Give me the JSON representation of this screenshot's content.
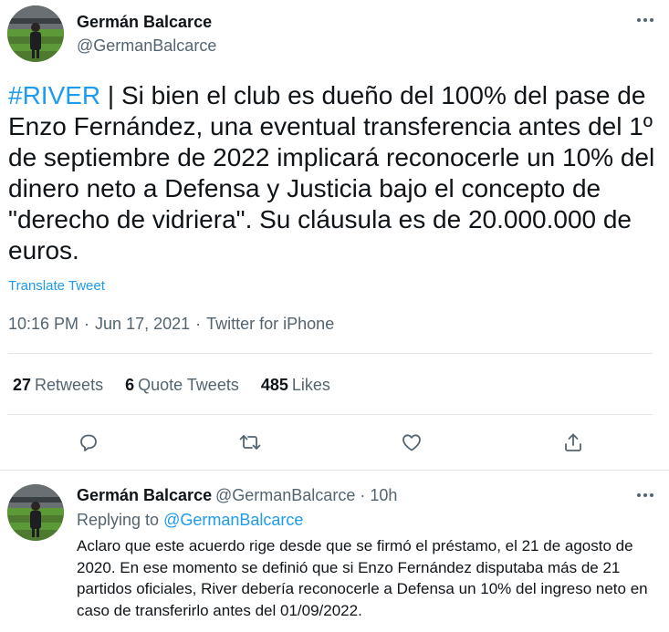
{
  "main_tweet": {
    "author_name": "Germán Balcarce",
    "author_handle": "@GermanBalcarce",
    "hashtag": "#RIVER",
    "text": " | Si bien el club es dueño del 100% del pase de Enzo Fernández, una eventual transferencia antes del 1º de septiembre de 2022 implicará reconocerle un 10% del dinero neto a Defensa y Justicia bajo el concepto de \"derecho de vidriera\". Su cláusula es de 20.000.000 de euros.",
    "translate_label": "Translate Tweet",
    "time": "10:16 PM",
    "date": "Jun 17, 2021",
    "source": "Twitter for iPhone",
    "separator": "·"
  },
  "stats": {
    "retweets_count": "27",
    "retweets_label": "Retweets",
    "quotes_count": "6",
    "quotes_label": "Quote Tweets",
    "likes_count": "485",
    "likes_label": "Likes"
  },
  "actions": [
    "reply-icon",
    "retweet-icon",
    "like-icon",
    "share-icon"
  ],
  "reply_tweet": {
    "author_name": "Germán Balcarce",
    "author_handle": "@GermanBalcarce",
    "separator": "·",
    "time_ago": "10h",
    "replying_prefix": "Replying to",
    "replying_to": "@GermanBalcarce",
    "text": "Aclaro que este acuerdo rige desde que se firmó el préstamo, el 21 de agosto de 2020. En ese momento se definió que si Enzo Fernández disputaba más de 21 partidos oficiales, River debería reconocerle a Defensa un 10% del ingreso neto en caso de transferirlo antes del 01/09/2022."
  },
  "colors": {
    "accent": "#1d9bf0",
    "text_primary": "#0f1419",
    "text_secondary": "#536471",
    "divider": "#e1e6ea"
  }
}
